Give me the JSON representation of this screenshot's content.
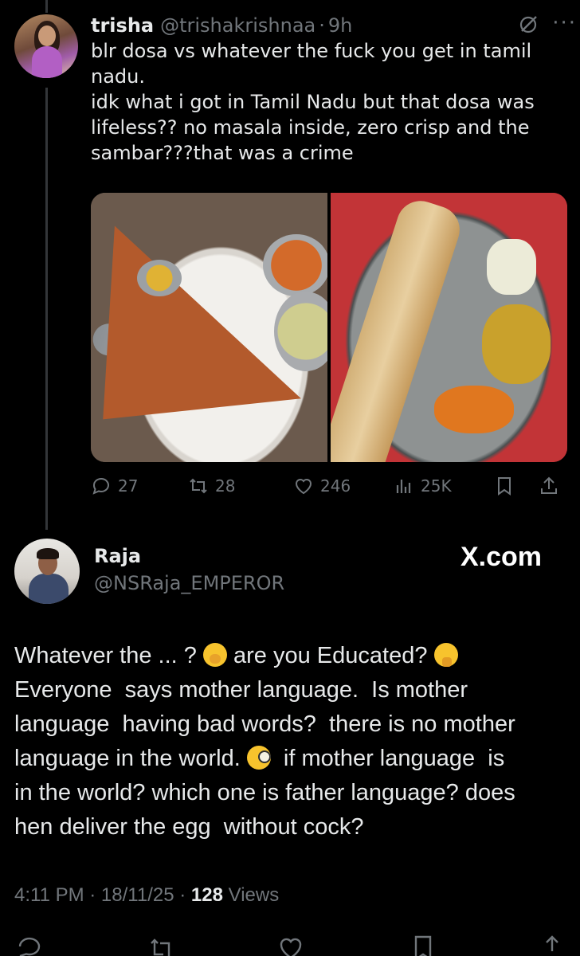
{
  "tweet": {
    "name": "trisha",
    "handle": "@trishakrishnaa",
    "separator": "·",
    "time": "9h",
    "text": "blr dosa vs whatever the fuck you get in tamil\nnadu.\nidk what i got in Tamil Nadu but that dosa was\nlifeless?? no masala inside, zero crisp and the\nsambar???that was a crime",
    "more_label": "···",
    "stats": {
      "replies": "27",
      "reposts": "28",
      "likes": "246",
      "views": "25K"
    }
  },
  "quote": {
    "name": "Raja",
    "handle": "@NSRaja_EMPEROR",
    "source": "X.com",
    "text_parts": [
      "Whatever the ... ? ",
      " are you Educated? ",
      "\nEveryone  says mother language.  Is mother\nlanguage  having bad words?  there is no mother\nlanguage in the world. ",
      "  if mother language  is\nin the world? which one is father language? does\nhen deliver the egg  without cock?"
    ],
    "emojis": [
      "hand-over-mouth-emoji",
      "thinking-emoji",
      "monocle-emoji"
    ],
    "meta_time": "4:11 PM · 18/11/25 · ",
    "meta_views_count": "128",
    "meta_views_label": " Views"
  },
  "icons": {
    "grok": "grok-icon",
    "reply": "reply-icon",
    "repost": "repost-icon",
    "like": "heart-icon",
    "views": "views-icon",
    "bookmark": "bookmark-icon",
    "share": "share-icon"
  },
  "colors": {
    "background": "#000000",
    "text_primary": "#e7e9ea",
    "text_secondary": "#71767b",
    "divider": "#333639"
  }
}
